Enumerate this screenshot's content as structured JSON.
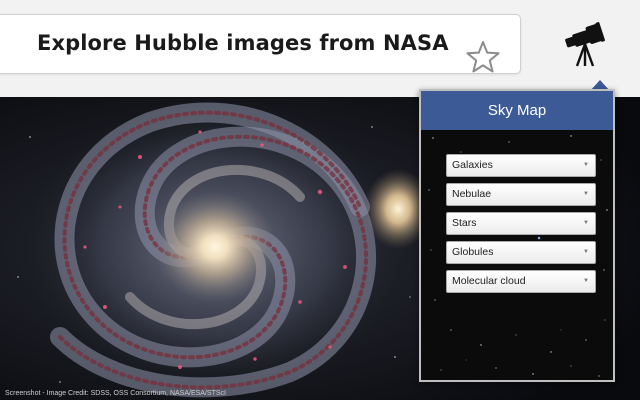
{
  "omnibox": {
    "title": "Explore Hubble images from NASA"
  },
  "icons": {
    "star": "star-outline-icon",
    "telescope": "telescope-icon"
  },
  "photo": {
    "credit": "Screenshot - Image Credit: SDSS, OSS Consortium, NASA/ESA/STScI"
  },
  "skymap": {
    "title": "Sky Map",
    "header_color": "#3c5a96",
    "selects": [
      {
        "value": "Galaxies"
      },
      {
        "value": "Nebulae"
      },
      {
        "value": "Stars"
      },
      {
        "value": "Globules"
      },
      {
        "value": "Molecular cloud"
      }
    ]
  }
}
